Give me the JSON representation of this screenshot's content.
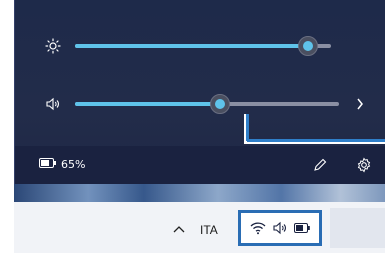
{
  "quick_settings": {
    "brightness": {
      "icon": "brightness-icon",
      "level": 0.91
    },
    "volume": {
      "icon": "speaker-icon",
      "level": 0.55
    },
    "battery_percent": "65%",
    "edit_icon": "pencil-icon",
    "settings_icon": "gear-icon"
  },
  "taskbar": {
    "language": "ITA",
    "tray_icons": [
      "wifi-icon",
      "speaker-icon",
      "battery-icon"
    ]
  },
  "colors": {
    "accent": "#5fc3ea",
    "callout": "#2f7fc9"
  }
}
